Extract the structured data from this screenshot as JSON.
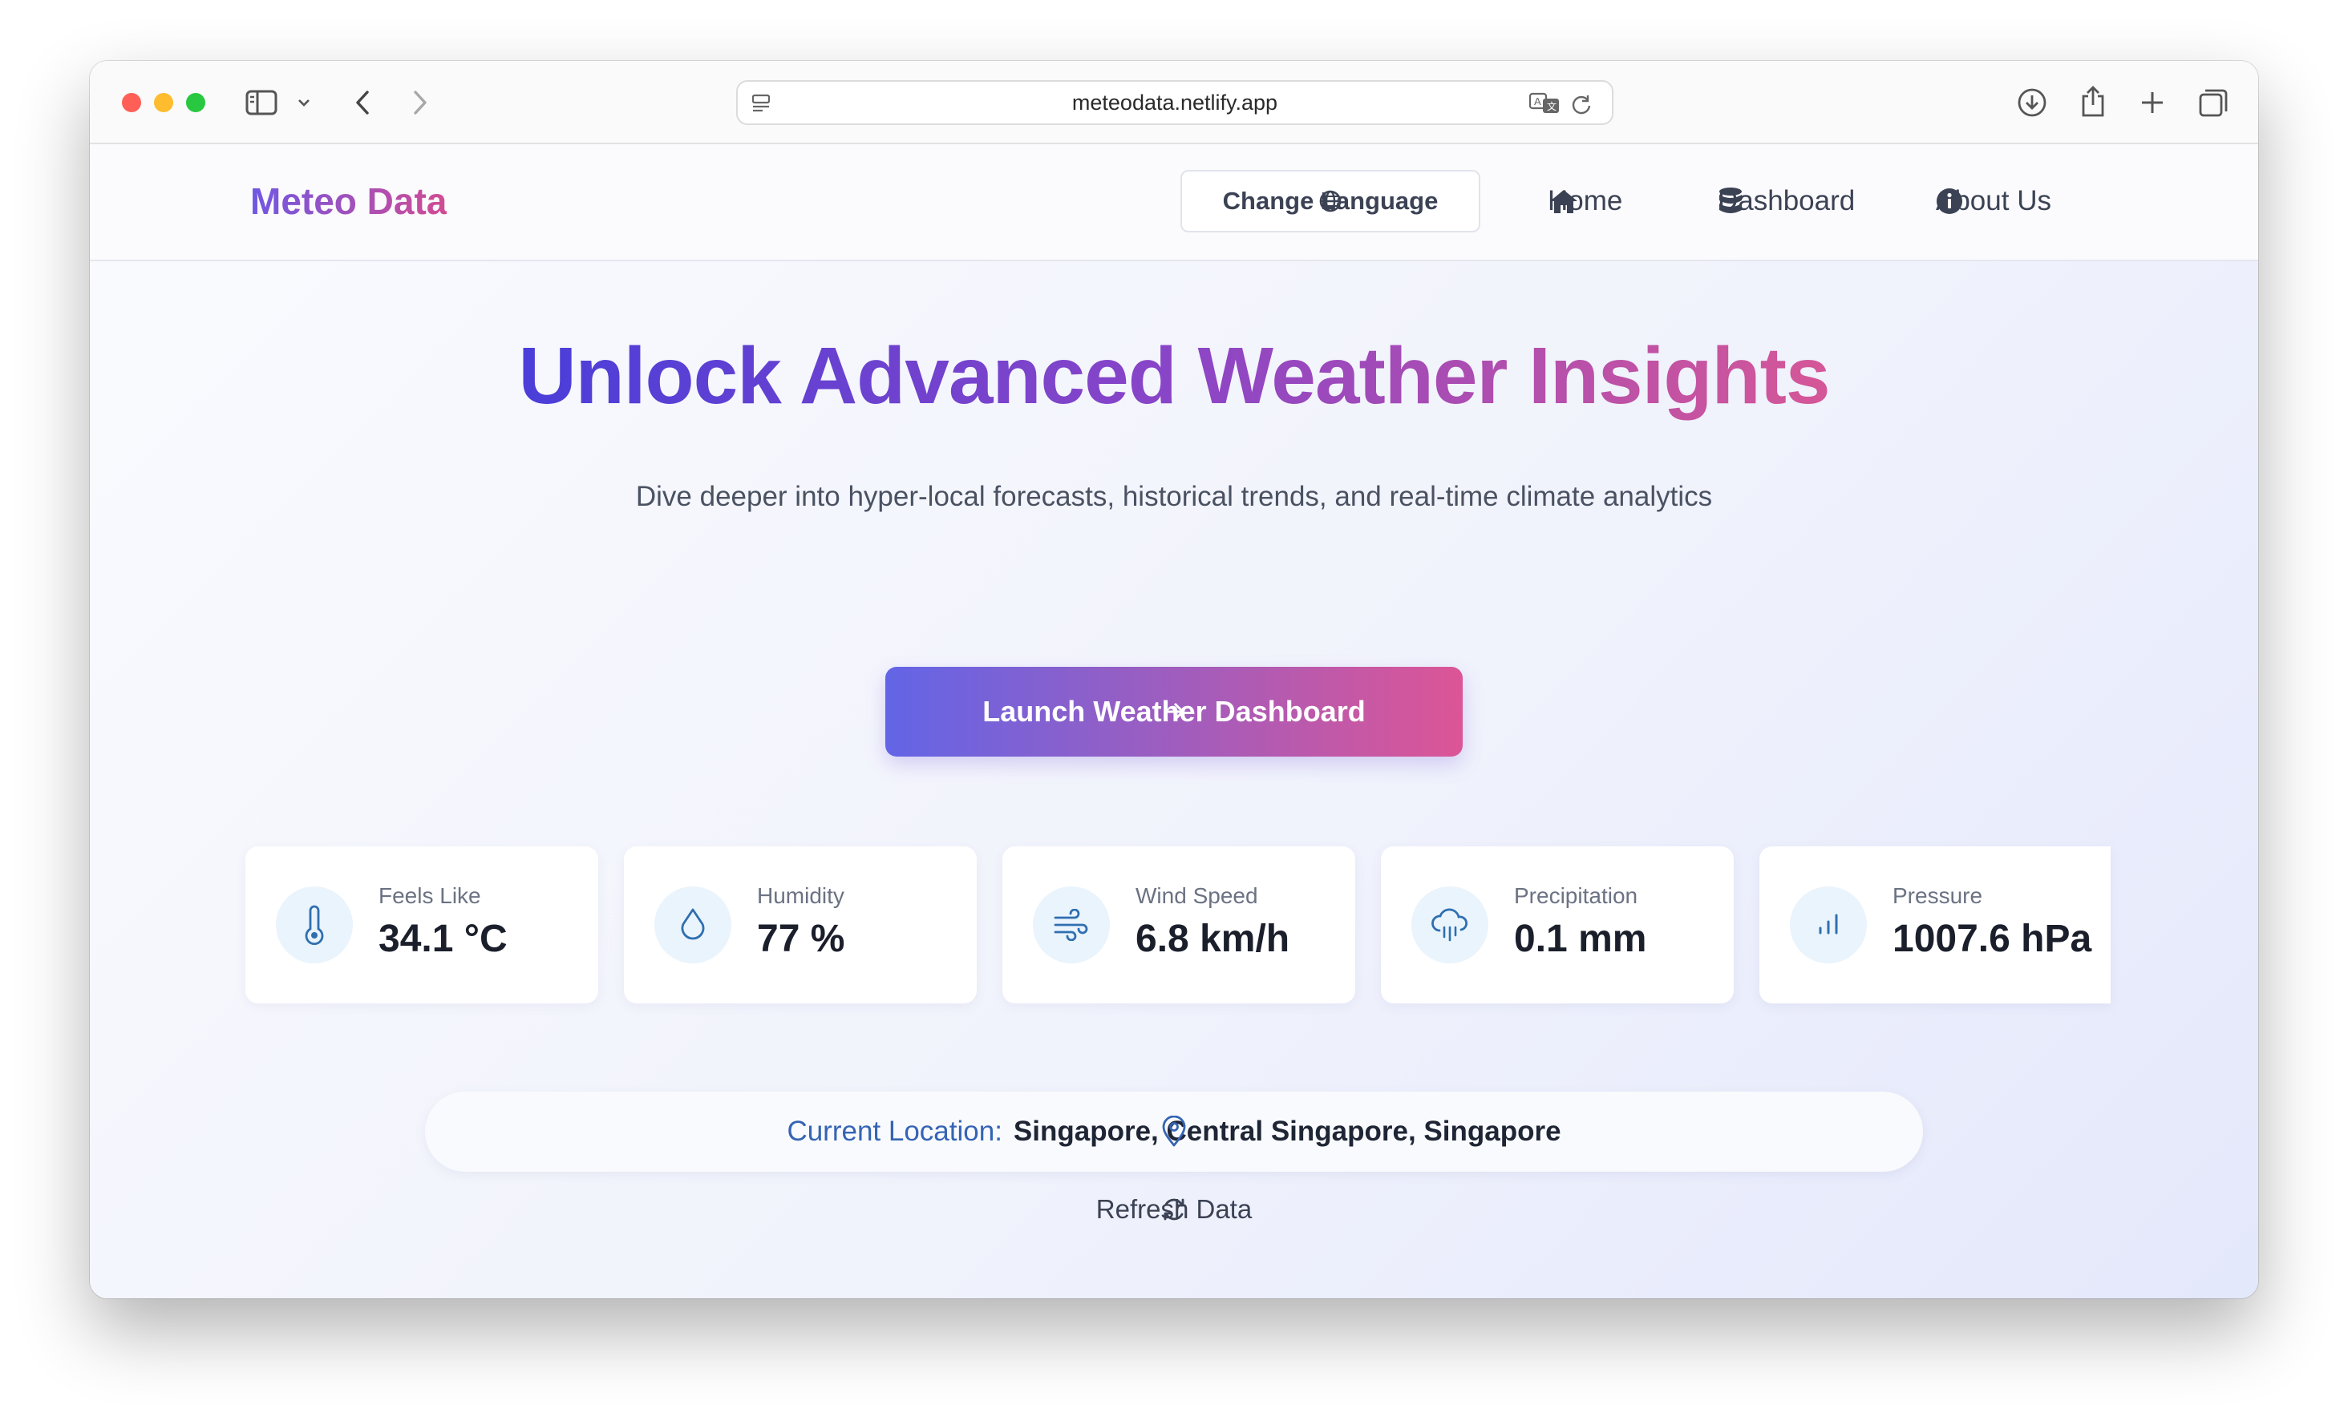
{
  "browser": {
    "url": "meteodata.netlify.app"
  },
  "nav": {
    "brand": "Meteo Data",
    "change_language": "Change Language",
    "links": [
      {
        "label": "Home",
        "icon": "home-icon"
      },
      {
        "label": "Dashboard",
        "icon": "database-icon"
      },
      {
        "label": "About Us",
        "icon": "info-icon"
      }
    ]
  },
  "hero": {
    "title": "Unlock Advanced Weather Insights",
    "subtitle": "Dive deeper into hyper-local forecasts, historical trends, and real-time climate analytics",
    "cta": "Launch Weather Dashboard"
  },
  "metrics": [
    {
      "label": "Feels Like",
      "value": "34.1 °C",
      "icon": "thermometer-icon"
    },
    {
      "label": "Humidity",
      "value": "77 %",
      "icon": "droplet-icon"
    },
    {
      "label": "Wind Speed",
      "value": "6.8 km/h",
      "icon": "wind-icon"
    },
    {
      "label": "Precipitation",
      "value": "0.1 mm",
      "icon": "cloud-rain-icon"
    },
    {
      "label": "Pressure",
      "value": "1007.6 hPa",
      "icon": "bar-chart-icon"
    }
  ],
  "location": {
    "label": "Current Location:",
    "value": "Singapore, Central Singapore, Singapore"
  },
  "refresh": "Refresh Data",
  "colors": {
    "brand_gradient_start": "#6f57e3",
    "brand_gradient_end": "#d24b93",
    "cta_gradient_start": "#6265e6",
    "cta_gradient_end": "#dc5596",
    "icon_blue": "#2f6fb0",
    "location_label": "#3564b4"
  }
}
